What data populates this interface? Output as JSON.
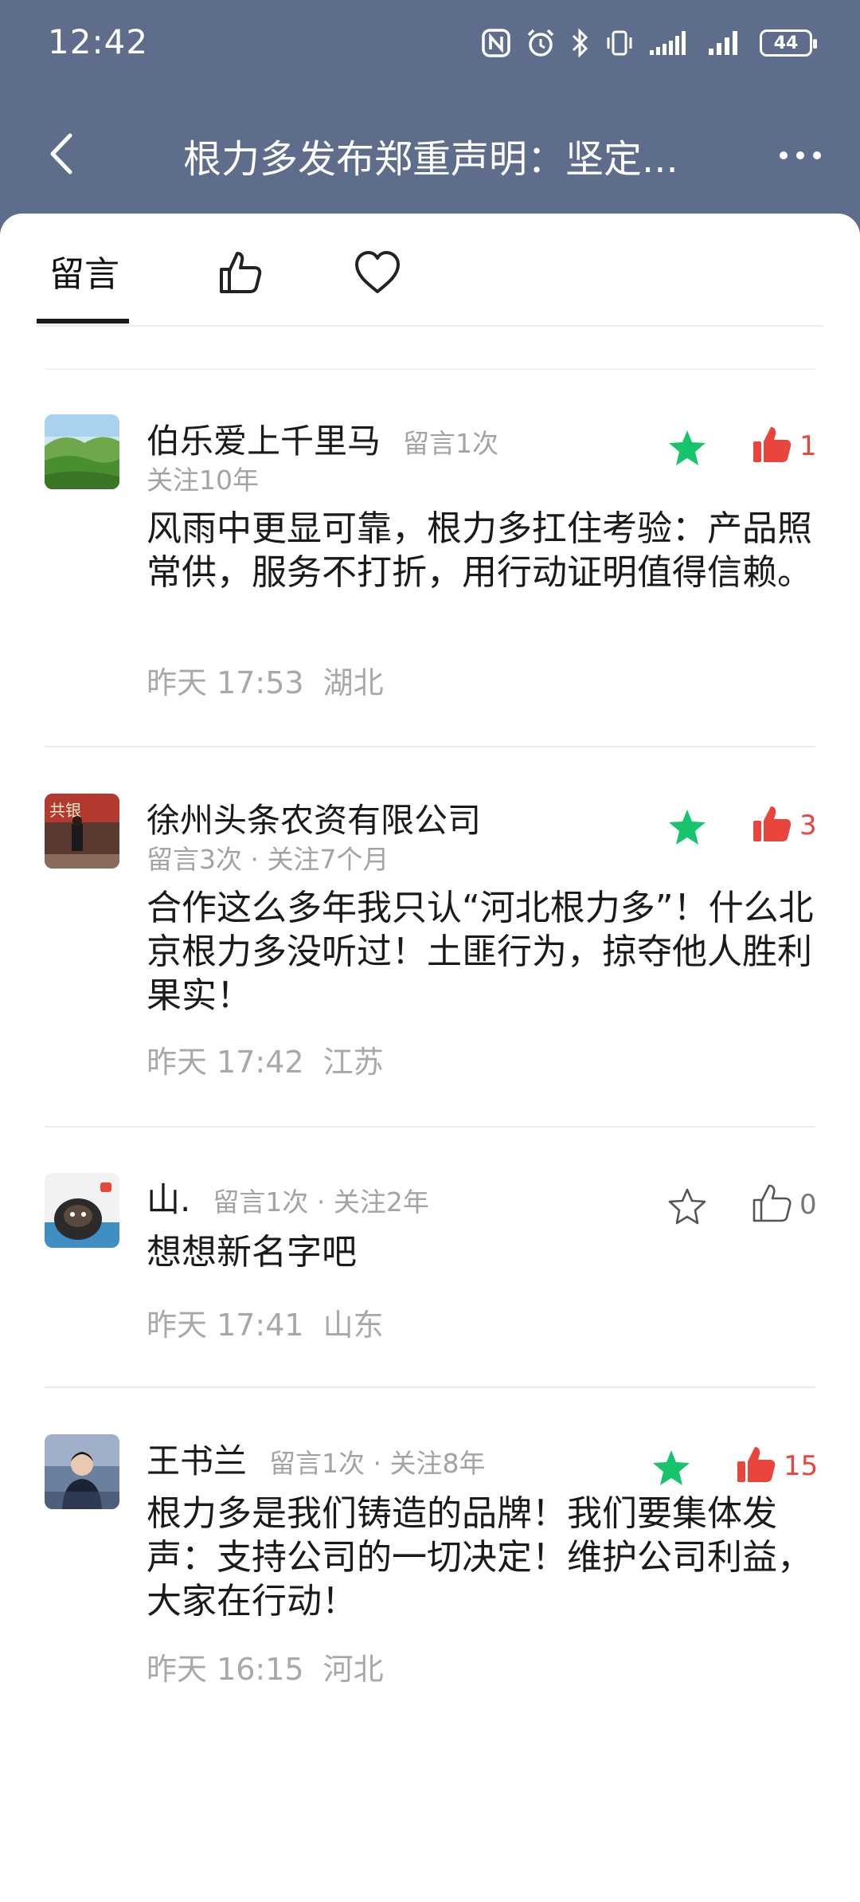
{
  "status_bar": {
    "time": "12:42",
    "battery": "44"
  },
  "nav": {
    "title": "根力多发布郑重声明：坚定..."
  },
  "tabs": {
    "comments_label": "留言"
  },
  "colors": {
    "header": "#5f6d8d",
    "star_green": "#16c56b",
    "like_red": "#e8453c"
  },
  "comments": [
    {
      "name": "伯乐爱上千里马",
      "meta_inline": "留言1次",
      "meta_below": "关注10年",
      "text": "风雨中更显可靠，根力多扛住考验：产品照常供，服务不打折，用行动证明值得信赖。",
      "time": "昨天 17:53",
      "region": "湖北",
      "starred": true,
      "liked": true,
      "likes": "1"
    },
    {
      "name": "徐州头条农资有限公司",
      "meta_below": "留言3次 · 关注7个月",
      "text": "合作这么多年我只认“河北根力多”！什么北京根力多没听过！土匪行为，掠夺他人胜利果实！",
      "time": "昨天 17:42",
      "region": "江苏",
      "starred": true,
      "liked": true,
      "likes": "3"
    },
    {
      "name": "山.",
      "meta_inline": "留言1次 · 关注2年",
      "text": "想想新名字吧",
      "time": "昨天 17:41",
      "region": "山东",
      "starred": false,
      "liked": false,
      "likes": "0"
    },
    {
      "name": "王书兰",
      "meta_inline": "留言1次 · 关注8年",
      "text": "根力多是我们铸造的品牌！我们要集体发声：支持公司的一切决定！维护公司利益，大家在行动！",
      "time": "昨天 16:15",
      "region": "河北",
      "starred": true,
      "liked": true,
      "likes": "15"
    }
  ]
}
